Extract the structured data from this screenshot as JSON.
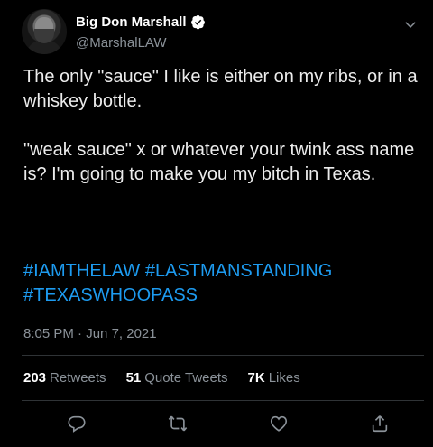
{
  "author": {
    "display_name": "Big Don Marshall",
    "handle": "@MarshalLAW",
    "verified": true
  },
  "tweet": {
    "text": "The only \"sauce\" I like is either on my ribs, or in a whiskey bottle.\n\n\"weak sauce\" x or whatever your twink ass name is? I'm going to make you my bitch in Texas.",
    "hashtags": [
      "#IAMTHELAW",
      "#LASTMANSTANDING",
      "#TEXASWHOOPASS"
    ],
    "time": "8:05 PM",
    "separator": "·",
    "date": "Jun 7, 2021"
  },
  "stats": {
    "retweets": {
      "count": "203",
      "label": "Retweets"
    },
    "quote_tweets": {
      "count": "51",
      "label": "Quote Tweets"
    },
    "likes": {
      "count": "7K",
      "label": "Likes"
    }
  },
  "icons": {
    "verified": "verified-badge-icon",
    "menu": "chevron-down-icon",
    "reply": "reply-icon",
    "retweet": "retweet-icon",
    "like": "heart-icon",
    "share": "share-icon"
  },
  "colors": {
    "background": "#000000",
    "text": "#ececec",
    "secondary": "#8b9299",
    "accent": "#1d9bf0",
    "divider": "#2f3336"
  }
}
